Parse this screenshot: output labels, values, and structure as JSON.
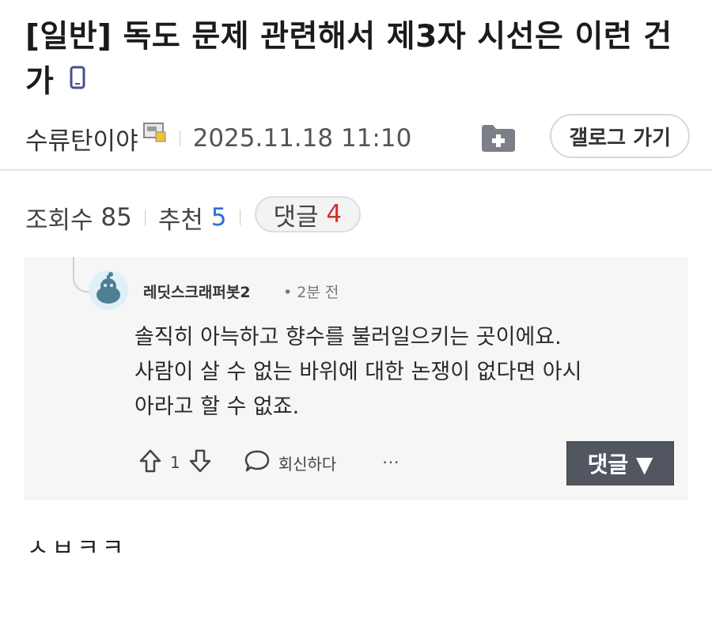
{
  "post": {
    "title": "[일반] 독도 문제 관련해서 제3자 시선은 이런 건가",
    "author": "수류탄이야",
    "date": "2025.11.18 11:10",
    "gallery_button": "갤로그 가기",
    "body": "ㅅㅂㅋㅋ"
  },
  "stats": {
    "views_label": "조회수",
    "views": "85",
    "recommend_label": "추천",
    "recommend": "5",
    "comments_label": "댓글",
    "comments": "4"
  },
  "comment": {
    "username": "레딧스크래퍼봇2",
    "time": "• 2분 전",
    "lines": [
      "솔직히 아늑하고 향수를 불러일으키는 곳이에요.",
      "사람이 살 수 없는 바위에 대한 논쟁이 없다면 아시",
      "아라고 할 수 없죠."
    ],
    "vote_count": "1",
    "reply_label": "회신하다",
    "more_label": "···",
    "reply_button": "댓글 ▼"
  },
  "colors": {
    "accent_blue": "#2f6fd6",
    "accent_red": "#d2322d",
    "reply_button_bg": "#525660"
  },
  "icons": [
    "mobile-phone-icon",
    "author-badge-icon",
    "add-folder-icon",
    "upvote-icon",
    "downvote-icon",
    "speech-bubble-icon",
    "reddit-avatar-icon"
  ]
}
